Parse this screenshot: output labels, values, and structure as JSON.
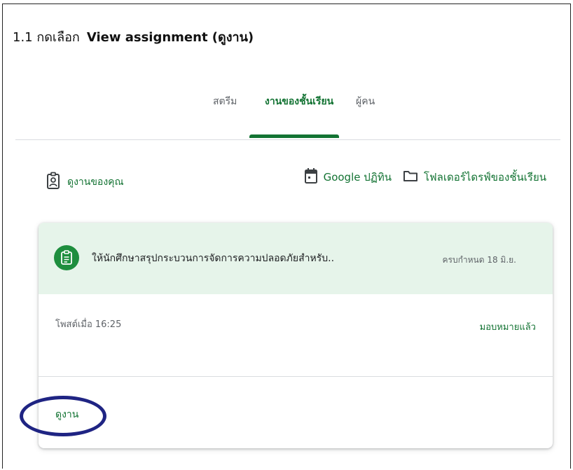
{
  "instruction": {
    "step": "1.1 กดเลือก",
    "action": "View assignment (ดูงาน)"
  },
  "tabs": [
    {
      "label": "สตรีม"
    },
    {
      "label": "งานของชั้นเรียน",
      "active": true
    },
    {
      "label": "ผู้คน"
    }
  ],
  "your_work": {
    "label": "ดูงานของคุณ",
    "icon": "assignment-ind-icon"
  },
  "toolbar": {
    "calendar_label": "Google ปฏิทิน",
    "drive_label": "โฟลเดอร์ไดรฟ์ของชั้นเรียน"
  },
  "assignment": {
    "title": "ให้นักศึกษาสรุปกระบวนการจัดการความปลอดภัยสำหรับ..",
    "due": "ครบกำหนด 18 มิ.ย.",
    "posted": "โพสต์เมื่อ 16:25",
    "status": "มอบหมายแล้ว",
    "view_link": "ดูงาน"
  },
  "colors": {
    "accent": "#137333",
    "header_bg": "#e6f4ea",
    "icon_bg": "#1e8e3e",
    "annotation_ring": "#1f2483"
  }
}
